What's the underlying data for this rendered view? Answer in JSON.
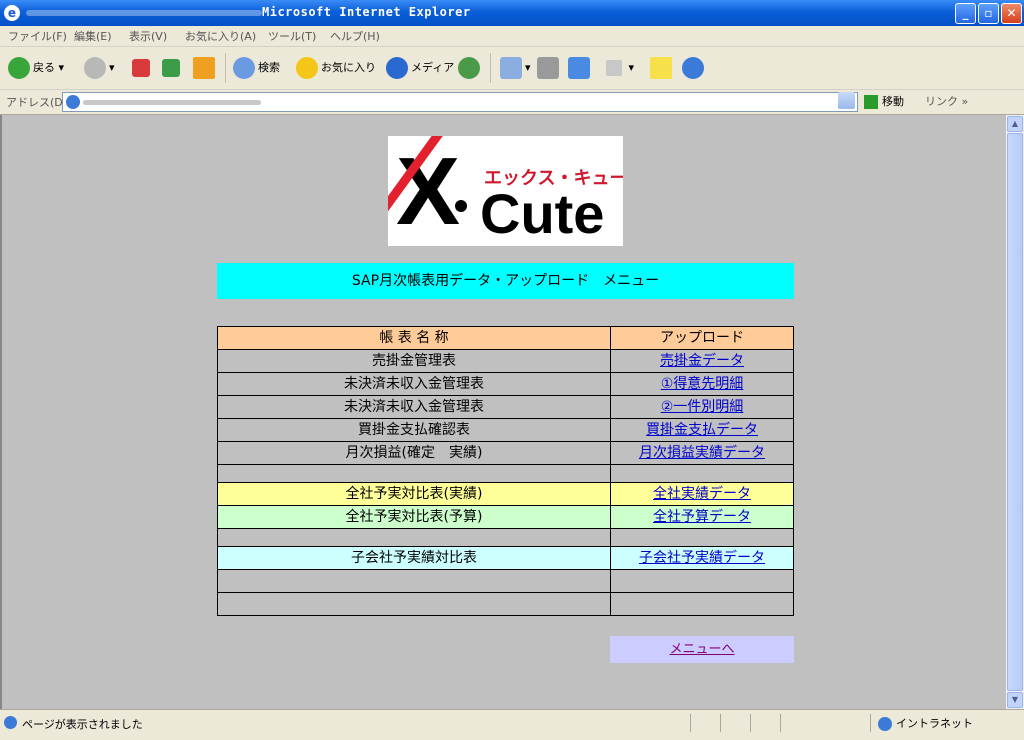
{
  "window": {
    "title": "Microsoft Internet Explorer"
  },
  "menu": [
    "ファイル(F)",
    "編集(E)",
    "表示(V)",
    "お気に入り(A)",
    "ツール(T)",
    "ヘルプ(H)"
  ],
  "toolbar": {
    "back": "戻る",
    "search": "検索",
    "favorites": "お気に入り",
    "media": "メディア"
  },
  "address": {
    "label": "アドレス(D)",
    "go": "移動",
    "links": "リンク"
  },
  "logo": {
    "letter": "X",
    "word": "Cute",
    "kana": "エックス・キュート"
  },
  "page": {
    "title": "SAP月次帳表用データ・アップロード　メニュー",
    "table": {
      "headers": [
        "帳 表 名 称",
        "アップロード"
      ],
      "rows": [
        {
          "name": "売掛金管理表",
          "link": "売掛金データ",
          "style": ""
        },
        {
          "name": "未決済未収入金管理表",
          "link": "①得意先明細",
          "style": ""
        },
        {
          "name": "未決済未収入金管理表",
          "link": "②一件別明細",
          "style": ""
        },
        {
          "name": "買掛金支払確認表",
          "link": "買掛金支払データ",
          "style": ""
        },
        {
          "name": "月次損益(確定　実績)",
          "link": "月次損益実績データ",
          "style": ""
        },
        {
          "name": "",
          "link": "",
          "style": "empty"
        },
        {
          "name": "全社予実対比表(実績)",
          "link": "全社実績データ",
          "style": "yellow"
        },
        {
          "name": "全社予実対比表(予算)",
          "link": "全社予算データ",
          "style": "green"
        },
        {
          "name": "",
          "link": "",
          "style": "empty"
        },
        {
          "name": "子会社予実績対比表",
          "link": "子会社予実績データ",
          "style": "cyan"
        },
        {
          "name": "",
          "link": "",
          "style": ""
        },
        {
          "name": "",
          "link": "",
          "style": ""
        }
      ]
    },
    "back_link": "メニューへ"
  },
  "status": {
    "message": "ページが表示されました",
    "zone": "イントラネット"
  }
}
